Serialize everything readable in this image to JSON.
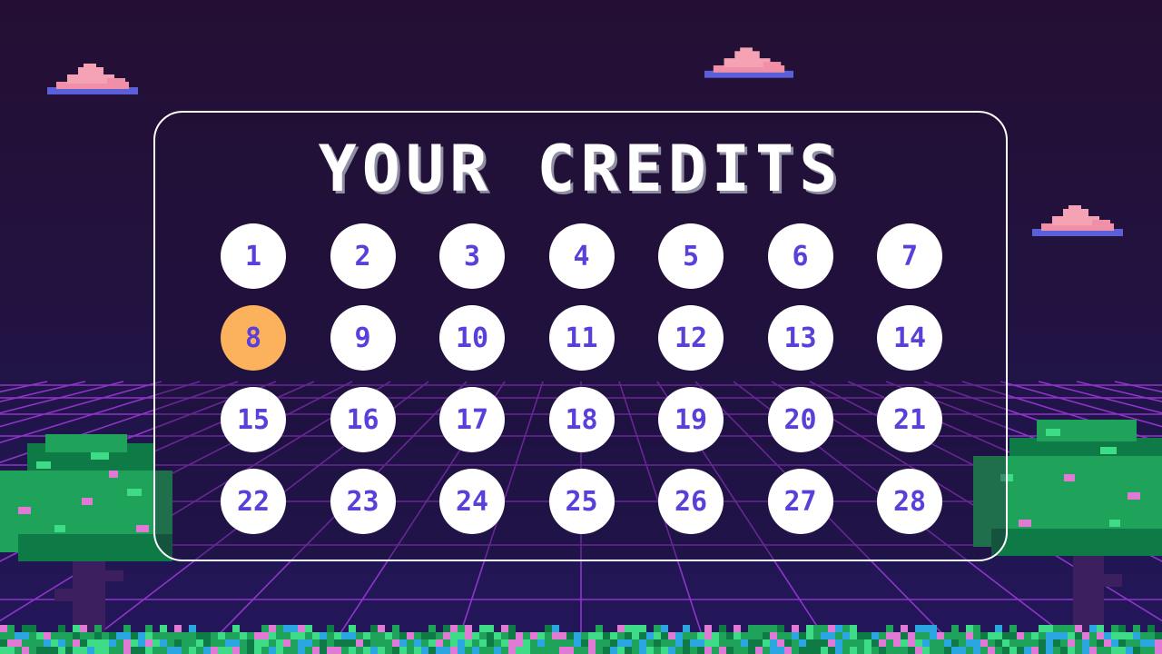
{
  "title": "YOUR CREDITS",
  "days": [
    "1",
    "2",
    "3",
    "4",
    "5",
    "6",
    "7",
    "8",
    "9",
    "10",
    "11",
    "12",
    "13",
    "14",
    "15",
    "16",
    "17",
    "18",
    "19",
    "20",
    "21",
    "22",
    "23",
    "24",
    "25",
    "26",
    "27",
    "28"
  ],
  "current_day": "8",
  "colors": {
    "sky_top": "#240f33",
    "sky_bottom": "#24165a",
    "grid_line": "#a43ae0",
    "day_circle": "#ffffff",
    "day_text": "#5b3fd9",
    "current_day_circle": "#fcb15c",
    "panel_border": "#ffffff",
    "cloud_pink": "#f08fa8",
    "cloud_blue": "#5b5fd9",
    "tree_green": "#1fa35a",
    "tree_trunk": "#3b1f5e"
  },
  "icons": [
    "cloud-icon",
    "tree-icon",
    "grass-icon"
  ]
}
